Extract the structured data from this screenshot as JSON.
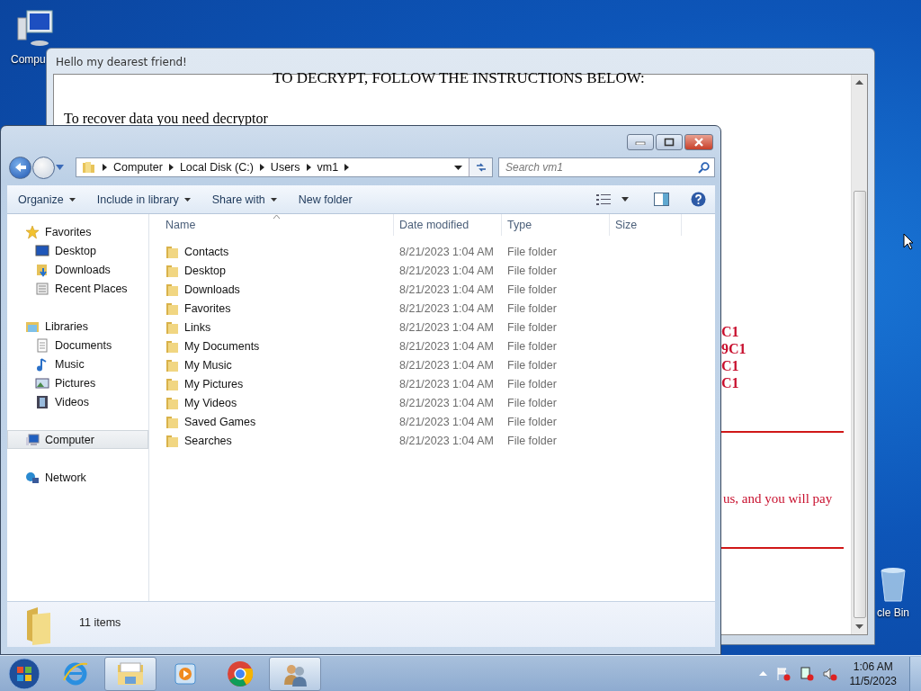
{
  "desktop_icons": [
    {
      "kind": "computer",
      "label": "Compu"
    },
    {
      "kind": "bin",
      "label": "cle Bin"
    }
  ],
  "note_window": {
    "title": "Hello my dearest friend!",
    "heading": "TO DECRYPT, FOLLOW THE INSTRUCTIONS BELOW:",
    "line": "To recover data you need decryptor",
    "red_fragments": [
      "C1",
      "9C1",
      "C1",
      "C1"
    ],
    "red_sentence": "us, and you will pay"
  },
  "explorer": {
    "breadcrumbs": [
      "Computer",
      "Local Disk (C:)",
      "Users",
      "vm1"
    ],
    "search": {
      "placeholder": "Search vm1"
    },
    "toolbar": [
      {
        "label": "Organize",
        "has_menu": true
      },
      {
        "label": "Include in library",
        "has_menu": true
      },
      {
        "label": "Share with",
        "has_menu": true
      },
      {
        "label": "New folder",
        "has_menu": false
      }
    ],
    "sidebar": [
      {
        "kind": "star",
        "label": "Favorites",
        "selected": false,
        "children": [
          {
            "kind": "desktop",
            "label": "Desktop",
            "selected": false
          },
          {
            "kind": "download",
            "label": "Downloads",
            "selected": false
          },
          {
            "kind": "recent",
            "label": "Recent Places",
            "selected": false
          }
        ]
      },
      {
        "kind": "library",
        "label": "Libraries",
        "selected": false,
        "children": [
          {
            "kind": "document",
            "label": "Documents",
            "selected": false
          },
          {
            "kind": "music",
            "label": "Music",
            "selected": false
          },
          {
            "kind": "picture",
            "label": "Pictures",
            "selected": false
          },
          {
            "kind": "video",
            "label": "Videos",
            "selected": false
          }
        ]
      },
      {
        "kind": "computer",
        "label": "Computer",
        "selected": true
      },
      {
        "kind": "network",
        "label": "Network",
        "selected": false
      }
    ],
    "columns": [
      "Name",
      "Date modified",
      "Type",
      "Size"
    ],
    "rows": [
      {
        "name": "Contacts",
        "date": "8/21/2023 1:04 AM",
        "type": "File folder"
      },
      {
        "name": "Desktop",
        "date": "8/21/2023 1:04 AM",
        "type": "File folder"
      },
      {
        "name": "Downloads",
        "date": "8/21/2023 1:04 AM",
        "type": "File folder"
      },
      {
        "name": "Favorites",
        "date": "8/21/2023 1:04 AM",
        "type": "File folder"
      },
      {
        "name": "Links",
        "date": "8/21/2023 1:04 AM",
        "type": "File folder"
      },
      {
        "name": "My Documents",
        "date": "8/21/2023 1:04 AM",
        "type": "File folder"
      },
      {
        "name": "My Music",
        "date": "8/21/2023 1:04 AM",
        "type": "File folder"
      },
      {
        "name": "My Pictures",
        "date": "8/21/2023 1:04 AM",
        "type": "File folder"
      },
      {
        "name": "My Videos",
        "date": "8/21/2023 1:04 AM",
        "type": "File folder"
      },
      {
        "name": "Saved Games",
        "date": "8/21/2023 1:04 AM",
        "type": "File folder"
      },
      {
        "name": "Searches",
        "date": "8/21/2023 1:04 AM",
        "type": "File folder"
      }
    ],
    "status": "11 items"
  },
  "taskbar": {
    "apps": [
      {
        "kind": "ie",
        "selected": false
      },
      {
        "kind": "explorer",
        "selected": true
      },
      {
        "kind": "media",
        "selected": false
      },
      {
        "kind": "chrome",
        "selected": false
      },
      {
        "kind": "users",
        "selected": true
      }
    ],
    "clock": {
      "time": "1:06 AM",
      "date": "11/5/2023"
    }
  }
}
